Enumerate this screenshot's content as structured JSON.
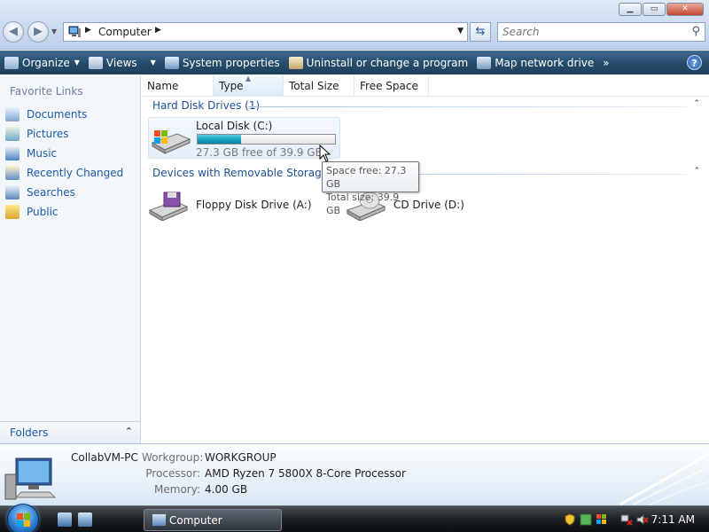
{
  "window": {
    "controls": {
      "minimize": "▁",
      "maximize": "▭",
      "close": "✕"
    }
  },
  "address": {
    "crumb": "Computer",
    "arrow": "▶",
    "dropdown": "▼",
    "refresh_icon": "refresh-icon"
  },
  "search": {
    "placeholder": "Search"
  },
  "toolbar": {
    "organize": "Organize",
    "views": "Views",
    "system_properties": "System properties",
    "uninstall": "Uninstall or change a program",
    "map_network": "Map network drive",
    "more": "»",
    "help": "?"
  },
  "sidebar": {
    "title": "Favorite Links",
    "items": [
      {
        "label": "Documents",
        "icon": "documents-icon"
      },
      {
        "label": "Pictures",
        "icon": "pictures-icon"
      },
      {
        "label": "Music",
        "icon": "music-icon"
      },
      {
        "label": "Recently Changed",
        "icon": "recently-changed-icon"
      },
      {
        "label": "Searches",
        "icon": "searches-icon"
      },
      {
        "label": "Public",
        "icon": "public-folder-icon"
      }
    ],
    "folders_label": "Folders",
    "folders_chevron": "⌃"
  },
  "columns": [
    "Name",
    "Type",
    "Total Size",
    "Free Space"
  ],
  "groups": {
    "hard_disk": {
      "label": "Hard Disk Drives (1)",
      "chevron": "⌃"
    },
    "removable": {
      "label": "Devices with Removable Storage (2)",
      "chevron": "⌃"
    }
  },
  "drives": {
    "local_disk": {
      "name": "Local Disk (C:)",
      "free_text": "27.3 GB free of 39.9 GB",
      "used_fraction": 0.316
    },
    "floppy": {
      "name": "Floppy Disk Drive (A:)"
    },
    "cd": {
      "name": "CD Drive (D:)"
    }
  },
  "tooltip": {
    "line1": "Space free: 27.3 GB",
    "line2": "Total size: 39.9 GB"
  },
  "details": {
    "pc_name": "CollabVM-PC",
    "workgroup_label": "Workgroup:",
    "workgroup": "WORKGROUP",
    "processor_label": "Processor:",
    "processor": "AMD Ryzen 7 5800X 8-Core Processor",
    "memory_label": "Memory:",
    "memory": "4.00 GB"
  },
  "taskbar": {
    "window_button": "Computer",
    "clock": "7:11 AM"
  },
  "colors": {
    "link": "#1d5aa8",
    "group_header": "#1d4f97",
    "toolbar_bg": "#264b6b",
    "capacity_fill": "#1aa3c0"
  }
}
